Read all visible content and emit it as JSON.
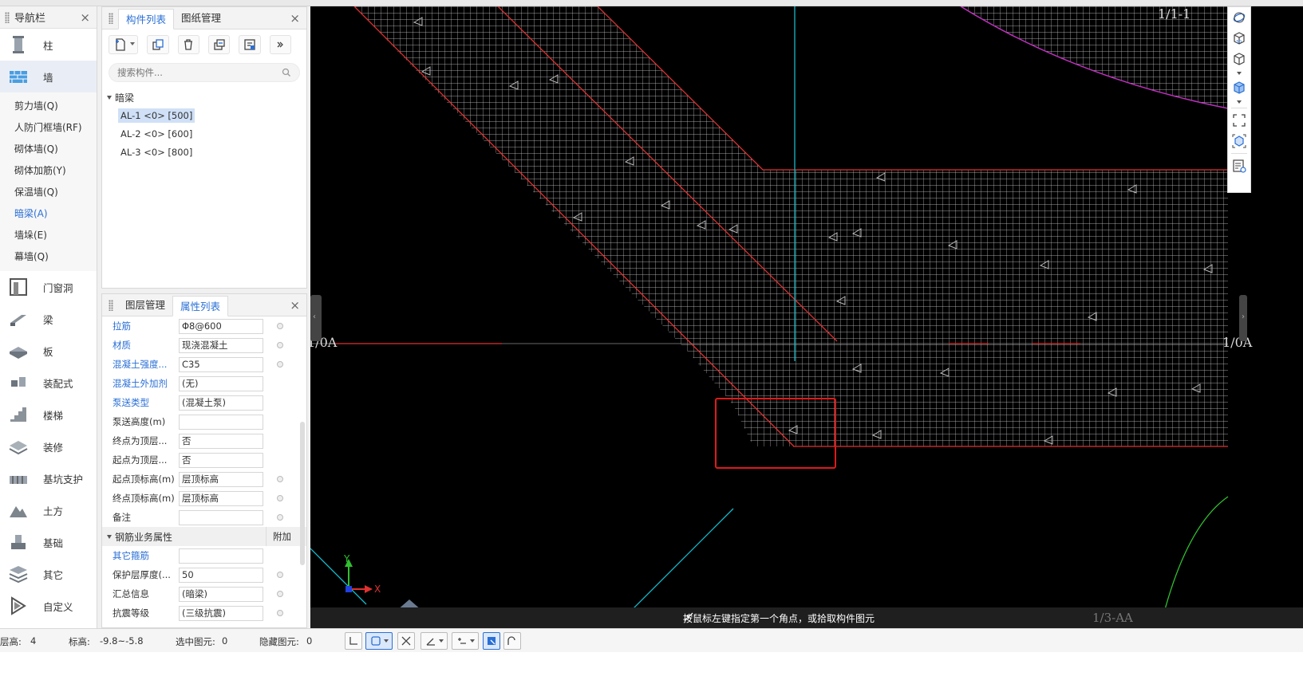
{
  "nav": {
    "title": "导航栏",
    "categories_top": [
      {
        "label": "柱",
        "icon": "column-icon"
      },
      {
        "label": "墙",
        "icon": "wall-icon",
        "active": true
      }
    ],
    "subitems": [
      {
        "label": "剪力墙(Q)"
      },
      {
        "label": "人防门框墙(RF)"
      },
      {
        "label": "砌体墙(Q)"
      },
      {
        "label": "砌体加筋(Y)"
      },
      {
        "label": "保温墙(Q)"
      },
      {
        "label": "暗梁(A)",
        "selected": true
      },
      {
        "label": "墙垛(E)"
      },
      {
        "label": "幕墙(Q)"
      }
    ],
    "categories_bottom": [
      {
        "label": "门窗洞",
        "icon": "door-window-icon"
      },
      {
        "label": "梁",
        "icon": "beam-icon"
      },
      {
        "label": "板",
        "icon": "slab-icon"
      },
      {
        "label": "装配式",
        "icon": "prefab-icon"
      },
      {
        "label": "楼梯",
        "icon": "stairs-icon"
      },
      {
        "label": "装修",
        "icon": "decoration-icon"
      },
      {
        "label": "基坑支护",
        "icon": "pit-support-icon"
      },
      {
        "label": "土方",
        "icon": "earthwork-icon"
      },
      {
        "label": "基础",
        "icon": "foundation-icon"
      },
      {
        "label": "其它",
        "icon": "other-icon"
      },
      {
        "label": "自定义",
        "icon": "custom-icon"
      }
    ]
  },
  "component_panel": {
    "tabs": [
      "构件列表",
      "图纸管理"
    ],
    "search_placeholder": "搜索构件...",
    "tree_root": "暗梁",
    "items": [
      "AL-1 <0> [500]",
      "AL-2 <0> [600]",
      "AL-3 <0> [800]"
    ]
  },
  "property_panel": {
    "tabs": [
      "图层管理",
      "属性列表"
    ],
    "rows": [
      {
        "name": "拉筋",
        "value": "Φ8@600",
        "blue": true,
        "dot": true
      },
      {
        "name": "材质",
        "value": "现浇混凝土",
        "blue": true,
        "dot": true
      },
      {
        "name": "混凝土强度...",
        "value": "C35",
        "blue": true,
        "dot": true
      },
      {
        "name": "混凝土外加剂",
        "value": "(无)",
        "blue": true,
        "dot": false
      },
      {
        "name": "泵送类型",
        "value": "(混凝土泵)",
        "blue": true,
        "dot": false
      },
      {
        "name": "泵送高度(m)",
        "value": "",
        "blue": false,
        "dot": false
      },
      {
        "name": "终点为顶层...",
        "value": "否",
        "blue": false,
        "dot": false
      },
      {
        "name": "起点为顶层...",
        "value": "否",
        "blue": false,
        "dot": false
      },
      {
        "name": "起点顶标高(m)",
        "value": "层顶标高",
        "blue": false,
        "dot": true
      },
      {
        "name": "终点顶标高(m)",
        "value": "层顶标高",
        "blue": false,
        "dot": true
      },
      {
        "name": "备注",
        "value": "",
        "blue": false,
        "dot": true
      }
    ],
    "section": {
      "label": "钢筋业务属性",
      "extra": "附加"
    },
    "rows2": [
      {
        "name": "其它箍筋",
        "value": "",
        "blue": true,
        "dot": false
      },
      {
        "name": "保护层厚度(...",
        "value": "50",
        "blue": false,
        "dot": true
      },
      {
        "name": "汇总信息",
        "value": "(暗梁)",
        "blue": false,
        "dot": true
      },
      {
        "name": "抗震等级",
        "value": "(三级抗震)",
        "blue": false,
        "dot": true
      }
    ]
  },
  "canvas": {
    "axis_left": "1/0A",
    "axis_right": "1/0A",
    "axis_bottom": "1/3-AA",
    "axis_top": "1/1-1",
    "x_axis": "X",
    "y_axis": "Y",
    "status_message": "按鼠标左键指定第一个角点，或拾取构件图元",
    "colors": {
      "background": "#000000",
      "red": "#e03030",
      "cyan": "#19b8c8",
      "magenta": "#c030c0",
      "green": "#30c030",
      "grid": "#cfcfcf"
    }
  },
  "status_bar": {
    "floor_height_label": "层高:",
    "floor_height_value": "4",
    "elevation_label": "标高:",
    "elevation_value": "-9.8~-5.8",
    "selected_label": "选中图元:",
    "selected_value": "0",
    "hidden_label": "隐藏图元:",
    "hidden_value": "0"
  }
}
